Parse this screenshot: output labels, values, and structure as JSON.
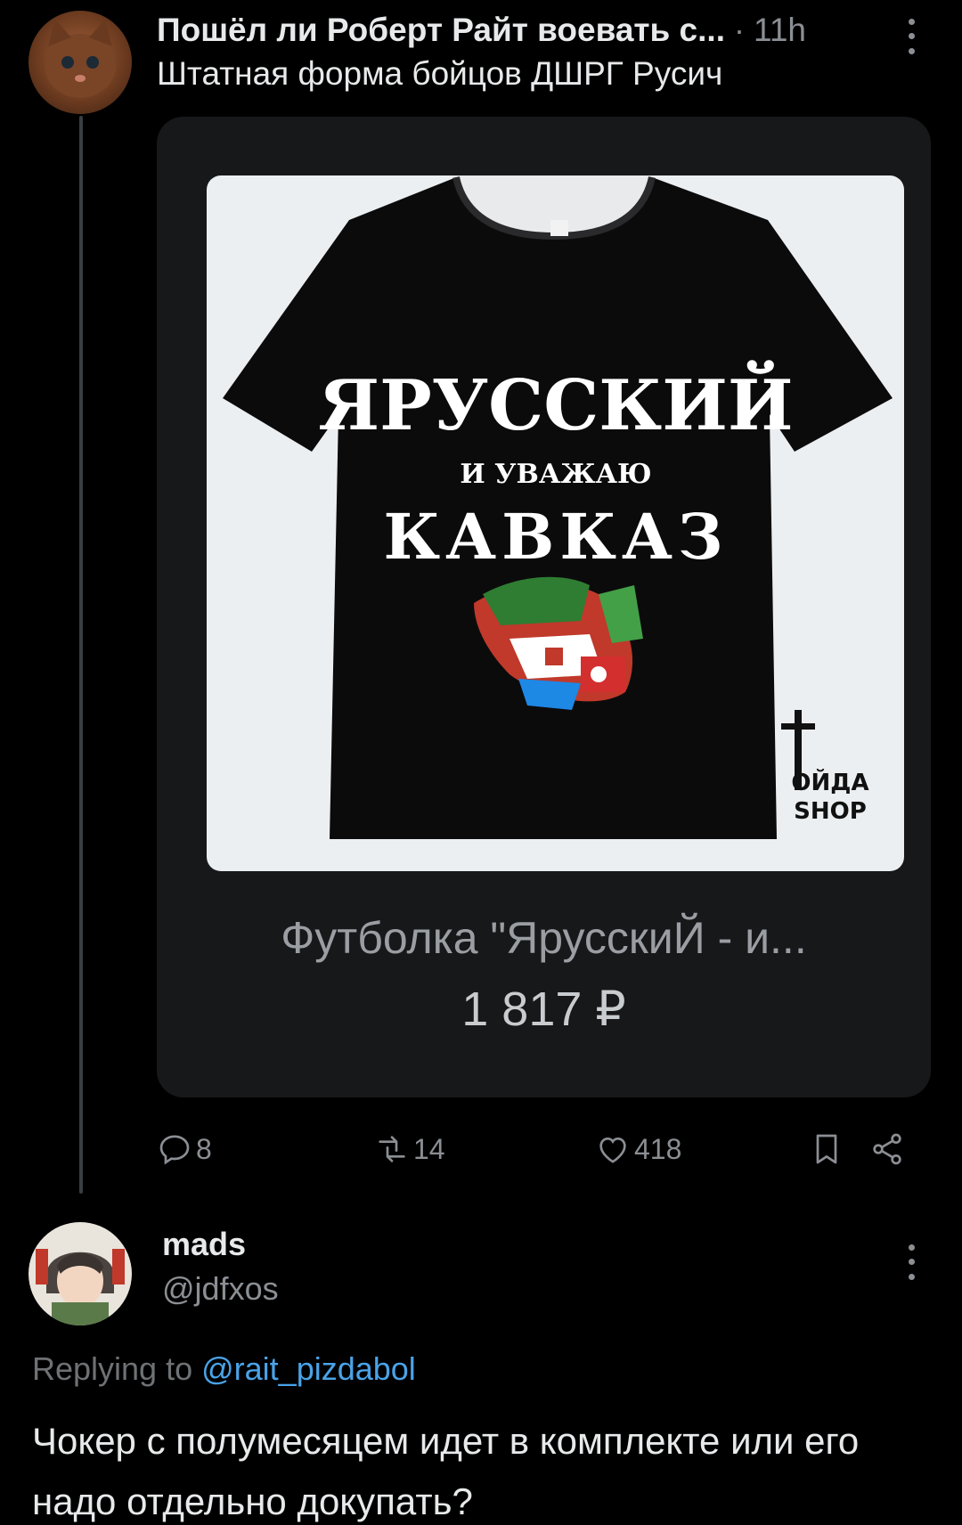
{
  "post": {
    "author_name": "Пошёл ли Роберт Райт воевать с...",
    "separator": "·",
    "time": "11h",
    "text": "Штатная форма бойцов ДШРГ Русич",
    "card": {
      "shirt_line1": "ЯРУССКИЙ",
      "shirt_line2": "И УВАЖАЮ",
      "shirt_line3": "КАВКАЗ",
      "brand_line1": "ОЙДА",
      "brand_line2": "SHOP",
      "title": "Футболка \"ЯрусскиЙ - и...",
      "price": "1 817 ₽"
    },
    "actions": {
      "replies": "8",
      "reposts": "14",
      "likes": "418"
    }
  },
  "reply": {
    "author_name": "mads",
    "handle": "@jdfxos",
    "replying_prefix": "Replying to",
    "replying_to": "@rait_pizdabol",
    "text": "Чокер с полумесяцем идет в комплекте или его надо отдельно докупать?"
  },
  "icons": [
    "more-icon",
    "reply-icon",
    "repost-icon",
    "like-icon",
    "bookmark-icon",
    "share-icon"
  ]
}
